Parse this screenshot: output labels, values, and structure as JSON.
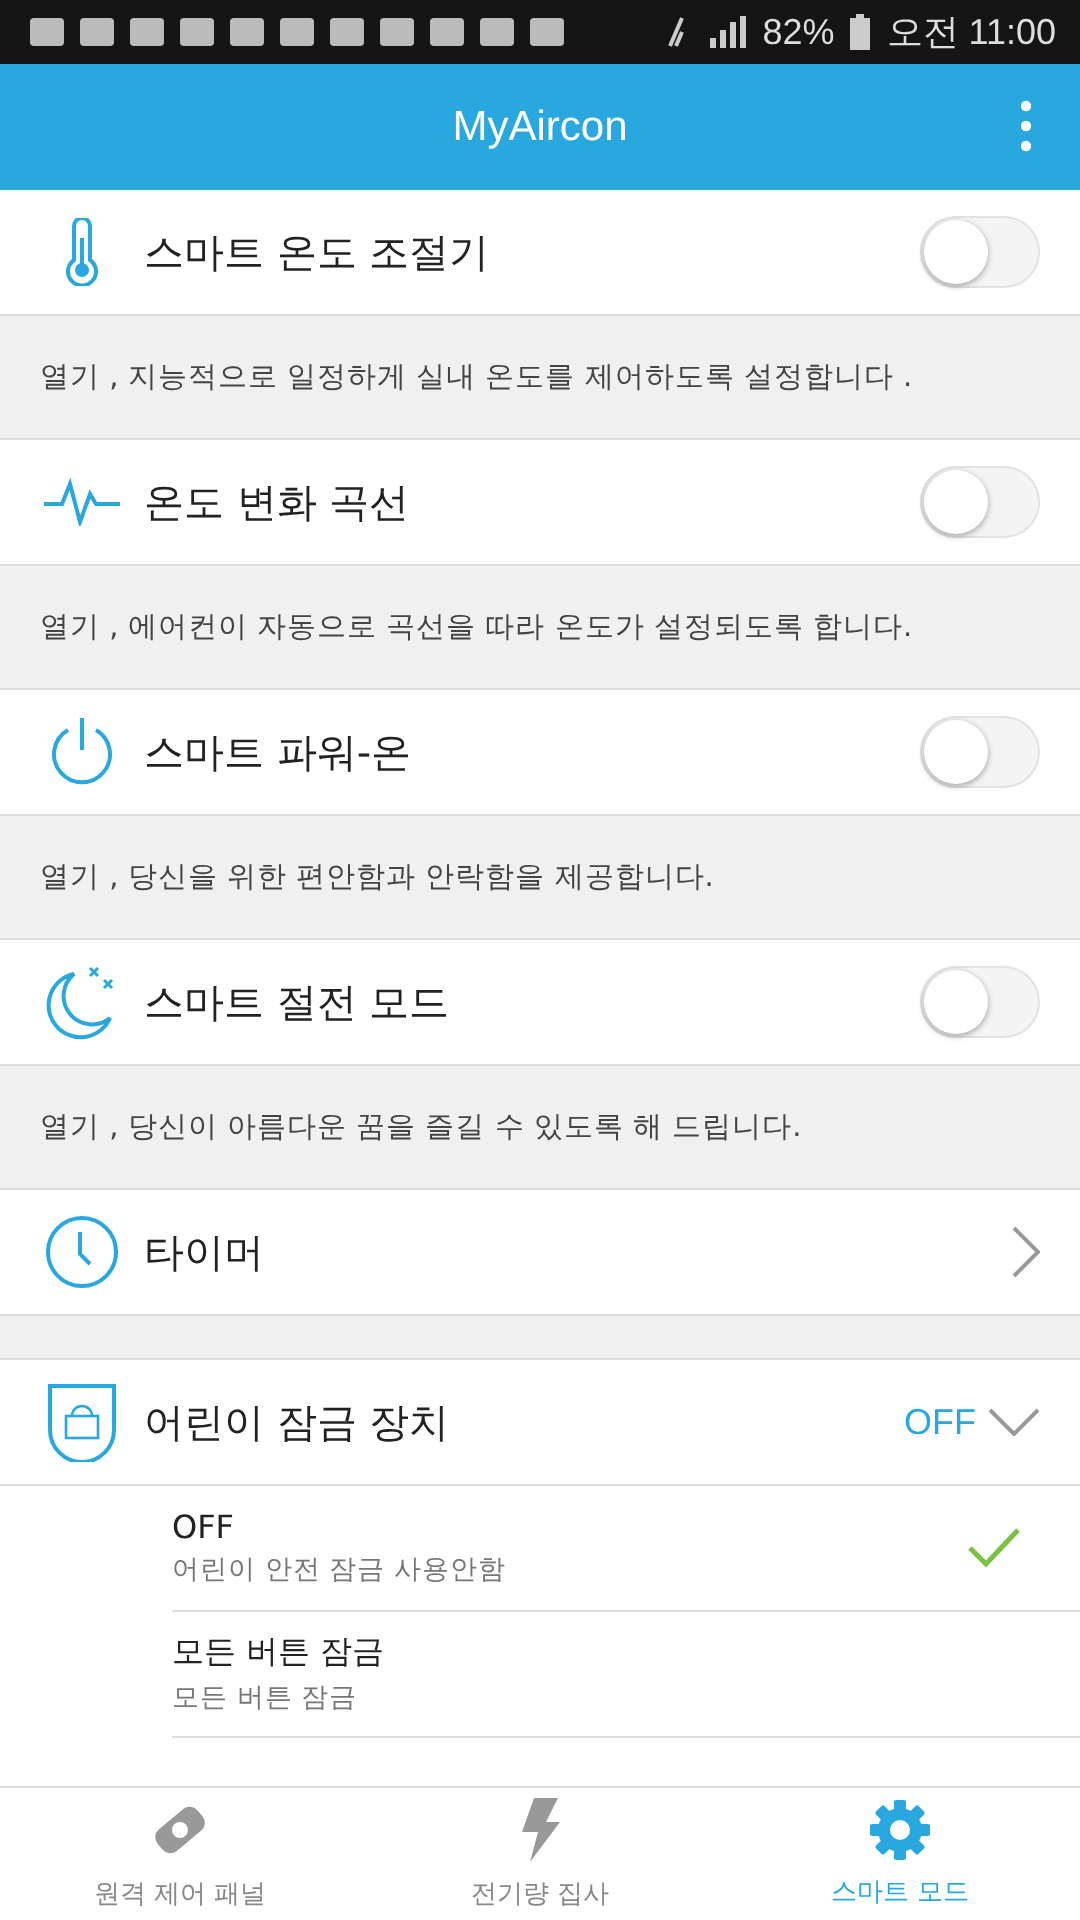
{
  "status_bar": {
    "battery": "82%",
    "time": "오전 11:00"
  },
  "app_bar": {
    "title": "MyAircon"
  },
  "settings": [
    {
      "kind": "toggle",
      "label": "스마트 온도 조절기",
      "on": false,
      "description": "열기 , 지능적으로 일정하게 실내 온도를 제어하도록 설정합니다 ."
    },
    {
      "kind": "toggle",
      "label": "온도 변화 곡선",
      "on": false,
      "description": "열기 , 에어컨이 자동으로 곡선을 따라 온도가 설정되도록 합니다."
    },
    {
      "kind": "toggle",
      "label": "스마트 파워-온",
      "on": false,
      "description": "열기 , 당신을 위한 편안함과 안락함을 제공합니다."
    },
    {
      "kind": "toggle",
      "label": "스마트 절전 모드",
      "on": false,
      "description": "열기 , 당신이 아름다운 꿈을 즐길 수 있도록 해 드립니다."
    },
    {
      "kind": "link",
      "label": "타이머"
    }
  ],
  "child_lock": {
    "label": "어린이 잠금 장치",
    "value": "OFF",
    "expanded": true,
    "options": [
      {
        "title": "OFF",
        "subtitle": "어린이 안전 잠금 사용안함",
        "selected": true
      },
      {
        "title": "모든 버튼 잠금",
        "subtitle": "모든 버튼 잠금",
        "selected": false
      }
    ]
  },
  "bottom_tabs": [
    {
      "label": "원격 제어 패널",
      "selected": false
    },
    {
      "label": "전기량 집사",
      "selected": false
    },
    {
      "label": "스마트 모드",
      "selected": true
    }
  ]
}
